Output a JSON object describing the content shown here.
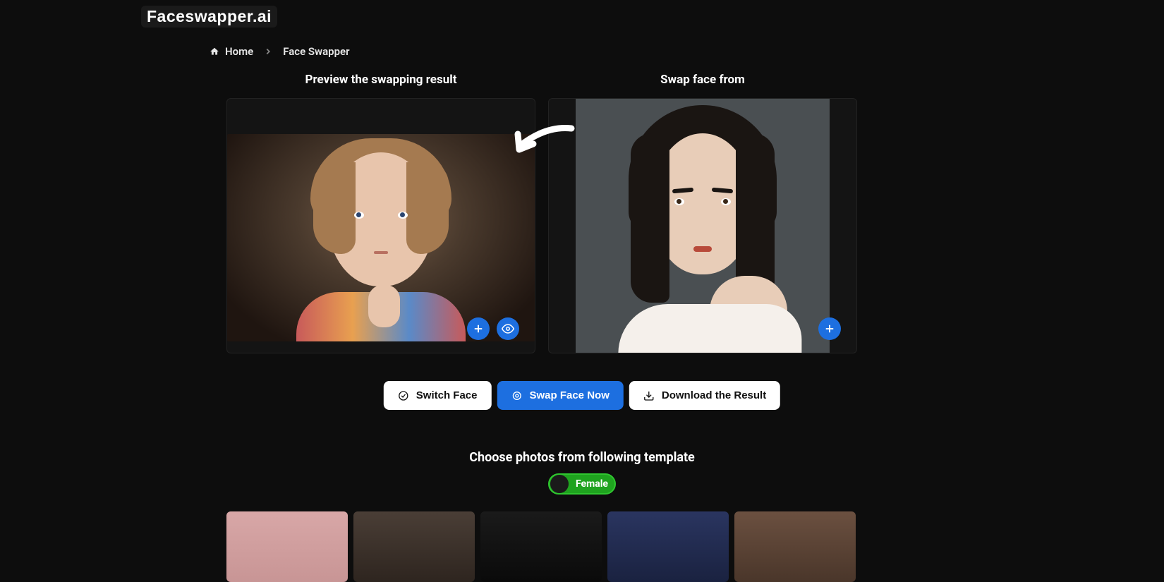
{
  "brand": "Faceswapper.ai",
  "breadcrumb": {
    "home": "Home",
    "current": "Face Swapper"
  },
  "panels": {
    "left_title": "Preview the swapping result",
    "right_title": "Swap face from"
  },
  "actions": {
    "switch": "Switch Face",
    "swap": "Swap Face Now",
    "download": "Download the Result"
  },
  "template_section": {
    "title": "Choose photos from following template",
    "toggle_label": "Female"
  }
}
